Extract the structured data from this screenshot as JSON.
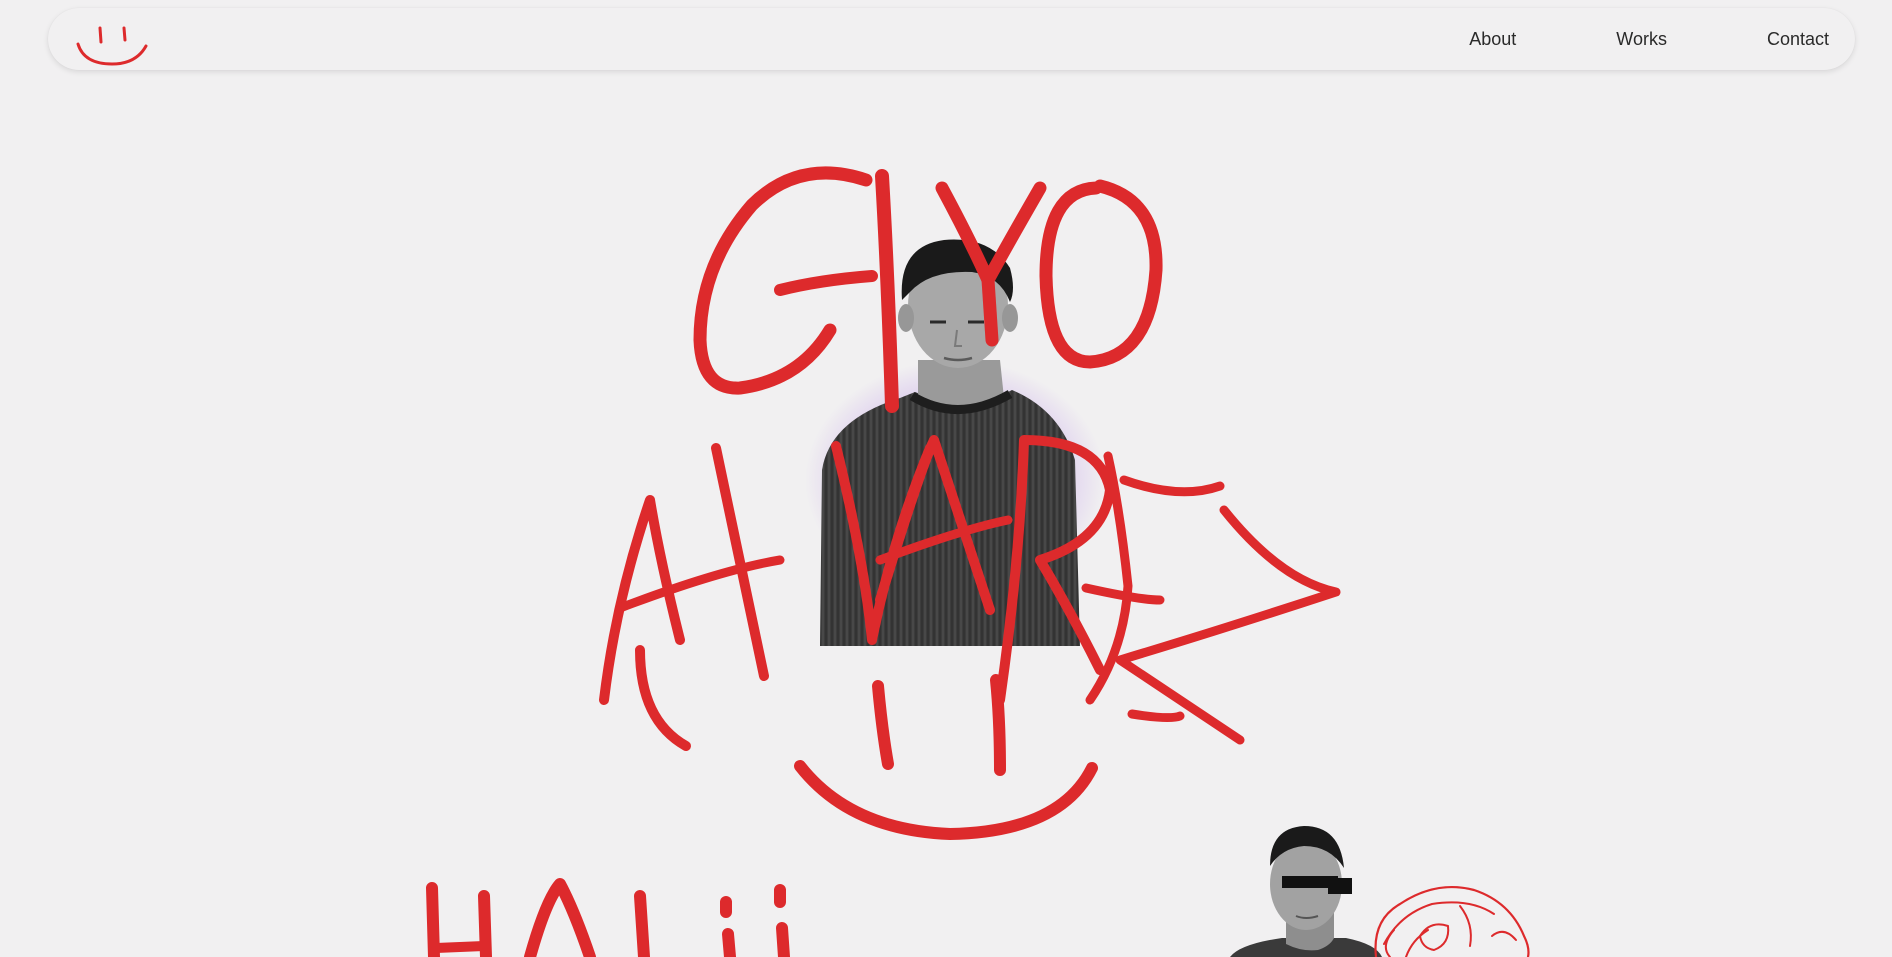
{
  "nav": {
    "logo_icon": "smiley-face-icon",
    "links": [
      {
        "label": "About"
      },
      {
        "label": "Works"
      },
      {
        "label": "Contact"
      }
    ]
  },
  "hero": {
    "name_first": "GIYO",
    "name_last": "ALVAREZ",
    "greeting": "HALii",
    "accent_color": "#dd2a2c",
    "portrait": "grayscale-portrait-photo",
    "small_portrait": "censored-eyes-portrait-photo",
    "doodle": "red-line-doodle-face-icon"
  }
}
